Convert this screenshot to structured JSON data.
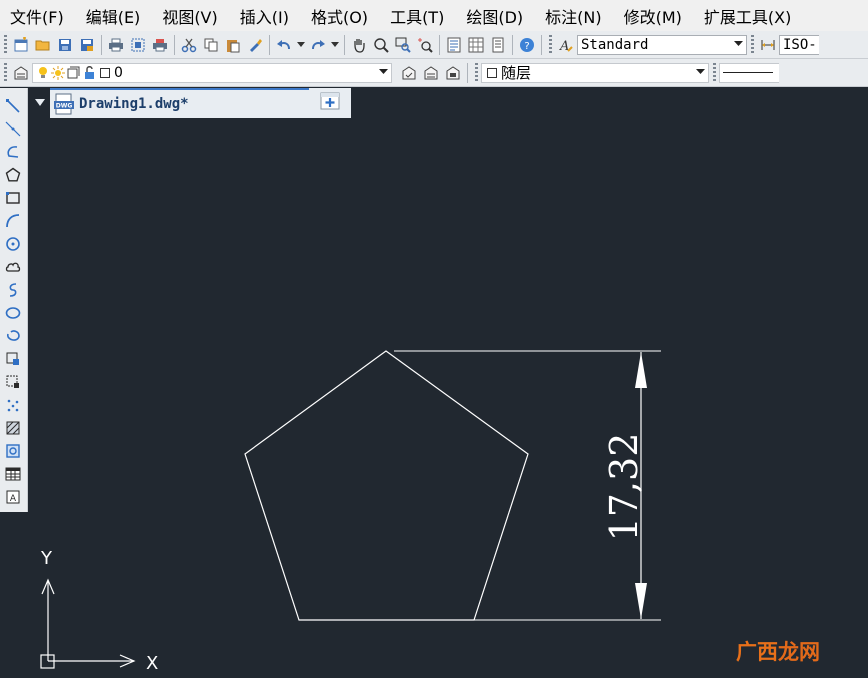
{
  "menubar": {
    "items": [
      "文件(F)",
      "编辑(E)",
      "视图(V)",
      "插入(I)",
      "格式(O)",
      "工具(T)",
      "绘图(D)",
      "标注(N)",
      "修改(M)",
      "扩展工具(X)"
    ]
  },
  "toolbar1": {
    "text_style": "Standard",
    "dim_style": "ISO-"
  },
  "toolbar2": {
    "layer_value": "0",
    "color_value": "随层"
  },
  "tab": {
    "label": "Drawing1.dwg*"
  },
  "drawing": {
    "dimension_text": "17,32",
    "ucs_x": "X",
    "ucs_y": "Y"
  },
  "watermark": {
    "part1": "广西",
    "part2": "龙网"
  },
  "colors": {
    "canvas_bg": "#212830",
    "line_white": "#ffffff",
    "tab_accent": "#3c78c8",
    "watermark": "#e8701a"
  }
}
